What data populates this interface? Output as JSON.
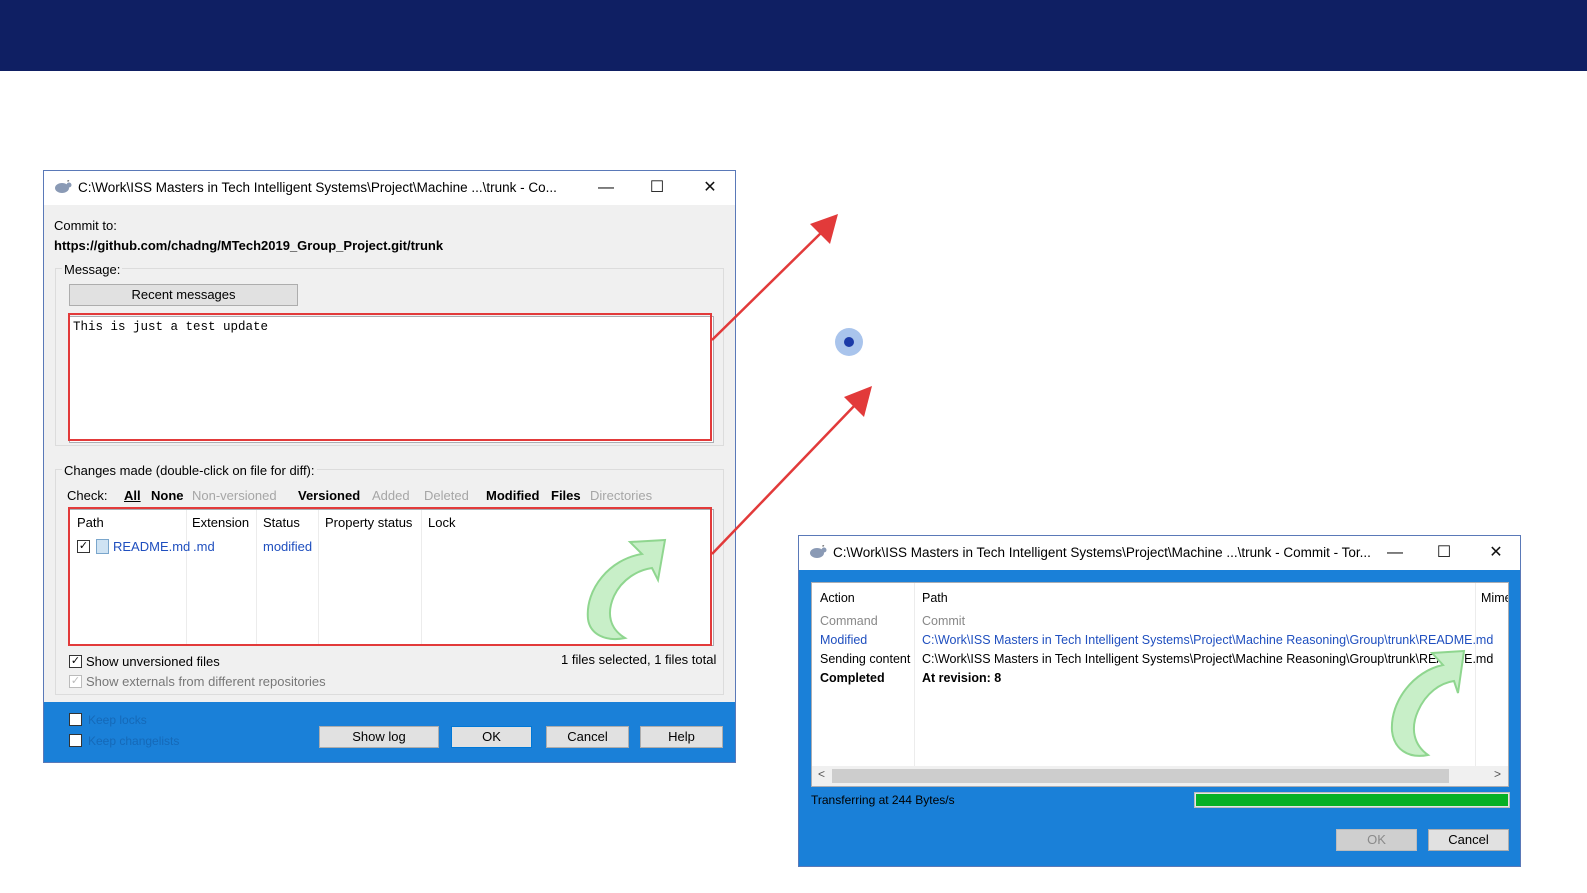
{
  "commit_dialog": {
    "title": "C:\\Work\\ISS Masters in Tech Intelligent Systems\\Project\\Machine ...\\trunk - Co...",
    "commit_to_label": "Commit to:",
    "commit_url": "https://github.com/chadng/MTech2019_Group_Project.git/trunk",
    "message_label": "Message:",
    "recent_messages_button": "Recent messages",
    "message_text": "This is just a test update",
    "changes_label": "Changes made (double-click on file for diff):",
    "check_label": "Check:",
    "filters": [
      "All",
      "None",
      "Non-versioned",
      "Versioned",
      "Added",
      "Deleted",
      "Modified",
      "Files",
      "Directories"
    ],
    "columns": [
      "Path",
      "Extension",
      "Status",
      "Property status",
      "Lock"
    ],
    "file_row": {
      "path": "README.md",
      "extension": ".md",
      "status": "modified",
      "checked": true
    },
    "show_unversioned": "Show unversioned files",
    "show_externals": "Show externals from different repositories",
    "selection_summary": "1 files selected, 1 files total",
    "hidden_opt1": "Keep locks",
    "hidden_opt2": "Keep changelists",
    "buttons": {
      "show_log": "Show log",
      "ok": "OK",
      "cancel": "Cancel",
      "help": "Help"
    }
  },
  "progress_dialog": {
    "title": "C:\\Work\\ISS Masters in Tech Intelligent Systems\\Project\\Machine ...\\trunk - Commit - Tor...",
    "columns": [
      "Action",
      "Path",
      "Mime"
    ],
    "rows": [
      {
        "action": "Command",
        "path": "Commit"
      },
      {
        "action": "Modified",
        "path": "C:\\Work\\ISS Masters in Tech Intelligent Systems\\Project\\Machine Reasoning\\Group\\trunk\\README.md"
      },
      {
        "action": "Sending content",
        "path": "C:\\Work\\ISS Masters in Tech Intelligent Systems\\Project\\Machine Reasoning\\Group\\trunk\\README.md"
      },
      {
        "action": "Completed",
        "path": "At revision: 8"
      }
    ],
    "transfer_status": "Transferring at 244 Bytes/s",
    "progress_fraction": 1.0,
    "buttons": {
      "ok": "OK",
      "cancel": "Cancel"
    }
  },
  "window_controls": {
    "minimize": "—",
    "maximize": "☐",
    "close": "✕"
  },
  "colors": {
    "header_bar": "#0f1f63",
    "dialog_footer": "#1a80d8",
    "highlight_box": "#e23a3a",
    "arrow": "#e23a3a",
    "progress": "#06b025",
    "link_blue": "#1f4fbf"
  }
}
